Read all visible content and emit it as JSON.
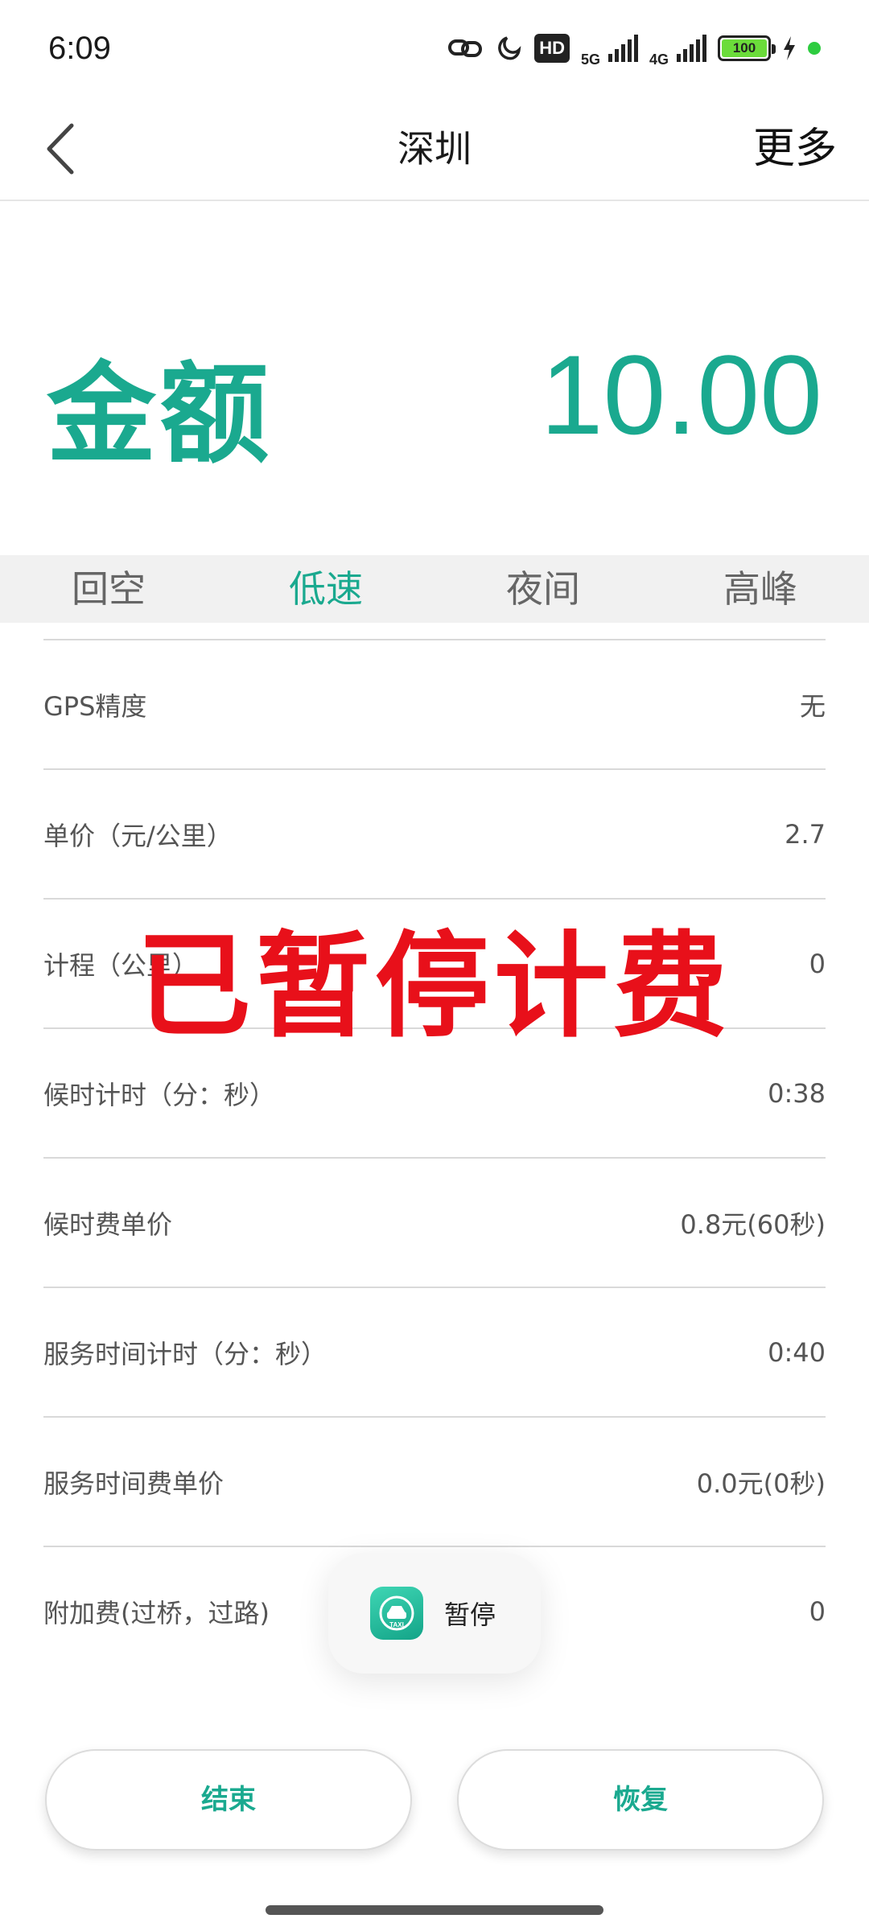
{
  "status_bar": {
    "time": "6:09",
    "hd_label": "HD",
    "net1": "5G",
    "net2": "4G",
    "battery": "100",
    "battery_color": "#6bdc3a"
  },
  "nav": {
    "back_icon": "chevron-left-icon",
    "title": "深圳",
    "more_label": "更多"
  },
  "fare": {
    "label": "金额",
    "amount": "10.00",
    "accent_color": "#1aa98f"
  },
  "tabs": [
    {
      "label": "回空",
      "active": false
    },
    {
      "label": "低速",
      "active": true
    },
    {
      "label": "夜间",
      "active": false
    },
    {
      "label": "高峰",
      "active": false
    }
  ],
  "rows": [
    {
      "label": "GPS精度",
      "value": "无"
    },
    {
      "label": "单价（元/公里）",
      "value": "2.7"
    },
    {
      "label": "计程（公里）",
      "value": "0"
    },
    {
      "label": "候时计时（分：秒）",
      "value": "0:38"
    },
    {
      "label": "候时费单价",
      "value": "0.8元(60秒)"
    },
    {
      "label": "服务时间计时（分：秒）",
      "value": "0:40"
    },
    {
      "label": "服务时间费单价",
      "value": "0.0元(0秒)"
    },
    {
      "label": "附加费(过桥，过路)",
      "value": "0"
    }
  ],
  "overlay": {
    "paused_text": "已暂停计费",
    "color": "#e8101a"
  },
  "toast": {
    "icon": "taxi-app-icon",
    "text": "暂停"
  },
  "buttons": {
    "end_label": "结束",
    "resume_label": "恢复"
  }
}
